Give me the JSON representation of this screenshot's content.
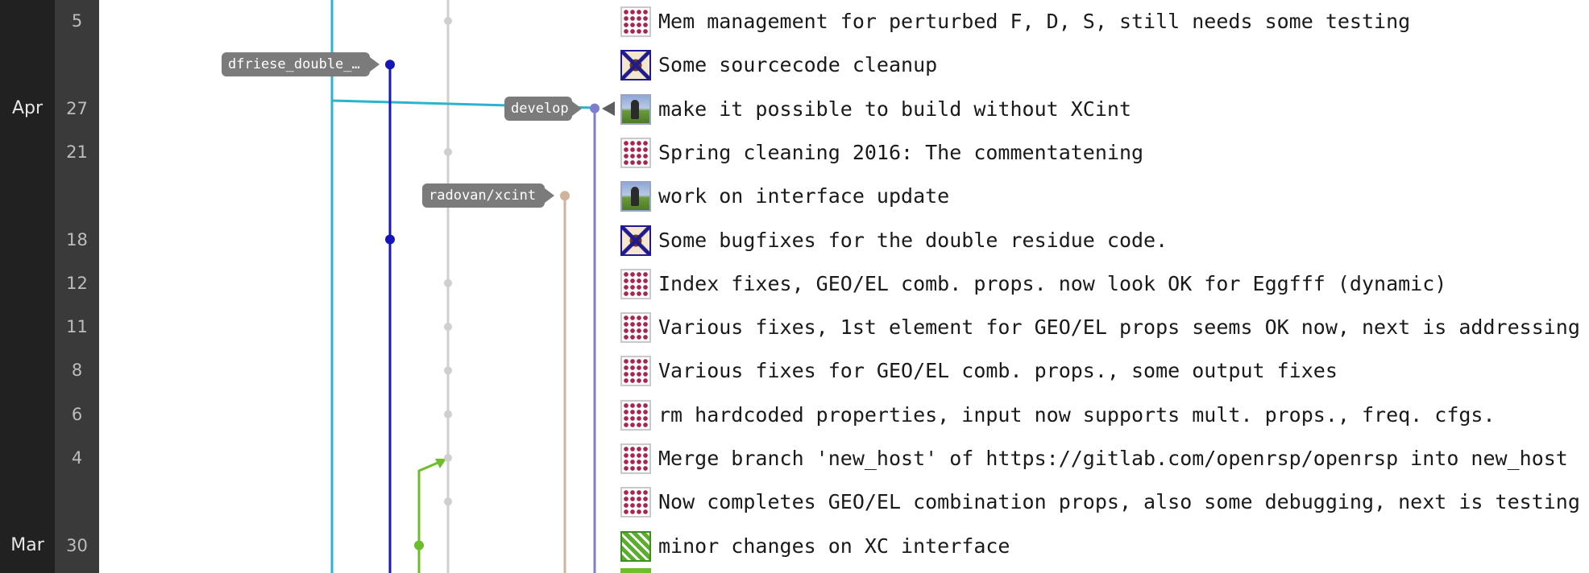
{
  "timeline": {
    "months": [
      {
        "label": "Apr",
        "row": 2
      },
      {
        "label": "Mar",
        "row": 12
      }
    ],
    "days": [
      {
        "label": "5",
        "row": 0
      },
      {
        "label": "27",
        "row": 2
      },
      {
        "label": "21",
        "row": 3
      },
      {
        "label": "18",
        "row": 5
      },
      {
        "label": "12",
        "row": 6
      },
      {
        "label": "11",
        "row": 7
      },
      {
        "label": "8",
        "row": 8
      },
      {
        "label": "6",
        "row": 9
      },
      {
        "label": "4",
        "row": 10
      },
      {
        "label": "30",
        "row": 12
      }
    ]
  },
  "refs": {
    "dfriese": "dfriese_double_…",
    "develop": "develop",
    "radovan": "radovan/xcint"
  },
  "colors": {
    "cyan_branch": "#2bb3cf",
    "blue_branch": "#1616b8",
    "gray_branch": "#cfcfcf",
    "tan_branch": "#cfb39c",
    "purple_branch": "#7d7ecf",
    "green_branch": "#6cbf2a",
    "ref_label_bg": "#7b7b7b"
  },
  "commits": [
    {
      "message": "Mem management for perturbed F, D, S, still needs some testing",
      "avatar": "dots-avatar"
    },
    {
      "message": "Some sourcecode cleanup",
      "avatar": "quilt-avatar"
    },
    {
      "message": "make it possible to build without XCint",
      "avatar": "photo-avatar"
    },
    {
      "message": "Spring cleaning 2016: The commentatening",
      "avatar": "dots-avatar"
    },
    {
      "message": "work on interface update",
      "avatar": "photo-avatar"
    },
    {
      "message": "Some bugfixes for the double residue code.",
      "avatar": "quilt-avatar"
    },
    {
      "message": "Index fixes, GEO/EL comb. props. now look OK for Eggfff (dynamic)",
      "avatar": "dots-avatar"
    },
    {
      "message": "Various fixes, 1st element for GEO/EL props seems OK now, next is addressing",
      "avatar": "dots-avatar"
    },
    {
      "message": "Various fixes for GEO/EL comb. props., some output fixes",
      "avatar": "dots-avatar"
    },
    {
      "message": "rm hardcoded properties, input now supports mult. props., freq. cfgs.",
      "avatar": "dots-avatar"
    },
    {
      "message": "Merge branch 'new_host' of https://gitlab.com/openrsp/openrsp into new_host",
      "avatar": "dots-avatar"
    },
    {
      "message": "Now completes GEO/EL combination props, also some debugging, next is testing",
      "avatar": "dots-avatar"
    },
    {
      "message": "minor changes on XC interface",
      "avatar": "green-avatar"
    }
  ]
}
